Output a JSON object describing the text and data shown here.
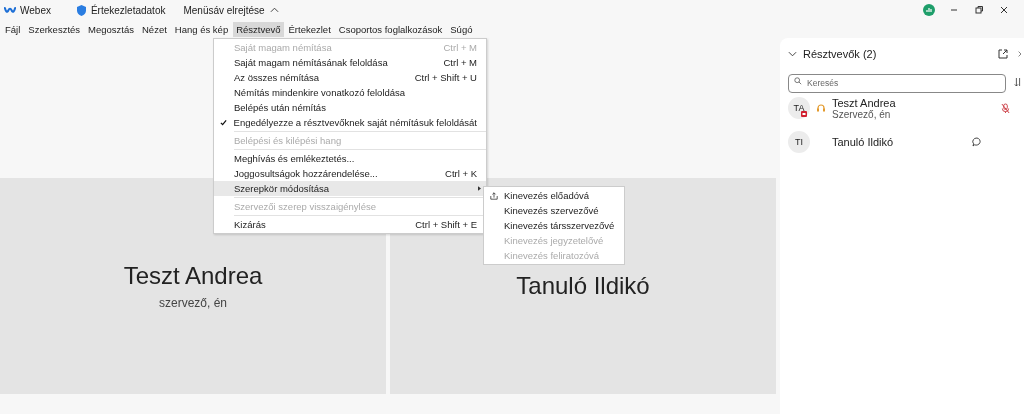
{
  "title_bar": {
    "app_name": "Webex",
    "meeting_info": "Értekezletadatok",
    "hide_menu": "Menüsáv elrejtése"
  },
  "menu_bar": [
    {
      "label": "Fájl",
      "selected": false
    },
    {
      "label": "Szerkesztés",
      "selected": false
    },
    {
      "label": "Megosztás",
      "selected": false
    },
    {
      "label": "Nézet",
      "selected": false
    },
    {
      "label": "Hang és kép",
      "selected": false
    },
    {
      "label": "Résztvevő",
      "selected": true
    },
    {
      "label": "Értekezlet",
      "selected": false
    },
    {
      "label": "Csoportos foglalkozások",
      "selected": false
    },
    {
      "label": "Súgó",
      "selected": false
    }
  ],
  "dropdown": [
    {
      "kind": "item",
      "label": "Saját magam némítása",
      "shortcut": "Ctrl + M",
      "disabled": true,
      "checked": false,
      "submenu": false,
      "selected": false
    },
    {
      "kind": "item",
      "label": "Saját magam némításának feloldása",
      "shortcut": "Ctrl + M",
      "disabled": false,
      "checked": false,
      "submenu": false,
      "selected": false
    },
    {
      "kind": "item",
      "label": "Az összes némítása",
      "shortcut": "Ctrl + Shift + U",
      "disabled": false,
      "checked": false,
      "submenu": false,
      "selected": false
    },
    {
      "kind": "item",
      "label": "Némítás mindenkire vonatkozó feloldása",
      "disabled": false,
      "checked": false,
      "submenu": false,
      "selected": false
    },
    {
      "kind": "item",
      "label": "Belépés után némítás",
      "disabled": false,
      "checked": false,
      "submenu": false,
      "selected": false
    },
    {
      "kind": "item",
      "label": "Engedélyezze a résztvevőknek saját némításuk feloldását",
      "disabled": false,
      "checked": true,
      "submenu": false,
      "selected": false
    },
    {
      "kind": "separator"
    },
    {
      "kind": "item",
      "label": "Belépési és kilépési hang",
      "disabled": true,
      "checked": false,
      "submenu": false,
      "selected": false
    },
    {
      "kind": "separator"
    },
    {
      "kind": "item",
      "label": "Meghívás és emlékeztetés...",
      "disabled": false,
      "checked": false,
      "submenu": false,
      "selected": false
    },
    {
      "kind": "item",
      "label": "Joggosultságok hozzárendelése...",
      "shortcut": "Ctrl + K",
      "disabled": false,
      "checked": false,
      "submenu": false,
      "selected": false
    },
    {
      "kind": "item",
      "label": "Szerepkör módosítása",
      "disabled": false,
      "checked": false,
      "submenu": true,
      "selected": true
    },
    {
      "kind": "separator"
    },
    {
      "kind": "item",
      "label": "Szervezői szerep visszaigénylése",
      "disabled": true,
      "checked": false,
      "submenu": false,
      "selected": false
    },
    {
      "kind": "separator"
    },
    {
      "kind": "item",
      "label": "Kizárás",
      "shortcut": "Ctrl + Shift + E",
      "disabled": false,
      "checked": false,
      "submenu": false,
      "selected": false
    }
  ],
  "submenu": [
    {
      "label": "Kinevezés előadóvá",
      "disabled": false,
      "current": true
    },
    {
      "label": "Kinevezés szervezővé",
      "disabled": false,
      "current": false
    },
    {
      "label": "Kinevezés társszervezővé",
      "disabled": false,
      "current": false
    },
    {
      "label": "Kinevezés jegyzetelővé",
      "disabled": true,
      "current": false
    },
    {
      "label": "Kinevezés feliratozóvá",
      "disabled": true,
      "current": false
    }
  ],
  "tiles": [
    {
      "name": "Teszt Andrea",
      "role": "szervező, én"
    },
    {
      "name": "Tanuló Ildikó"
    }
  ],
  "panel": {
    "title": "Résztvevők (2)",
    "search": {
      "placeholder": "Keresés"
    },
    "participants": [
      {
        "initials": "TA",
        "name": "Teszt Andrea",
        "role": "Szervező, én",
        "host": true,
        "muted": true,
        "chat": false
      },
      {
        "initials": "TI",
        "name": "Tanuló Ildikó",
        "host": false,
        "muted": false,
        "chat": true
      }
    ]
  }
}
